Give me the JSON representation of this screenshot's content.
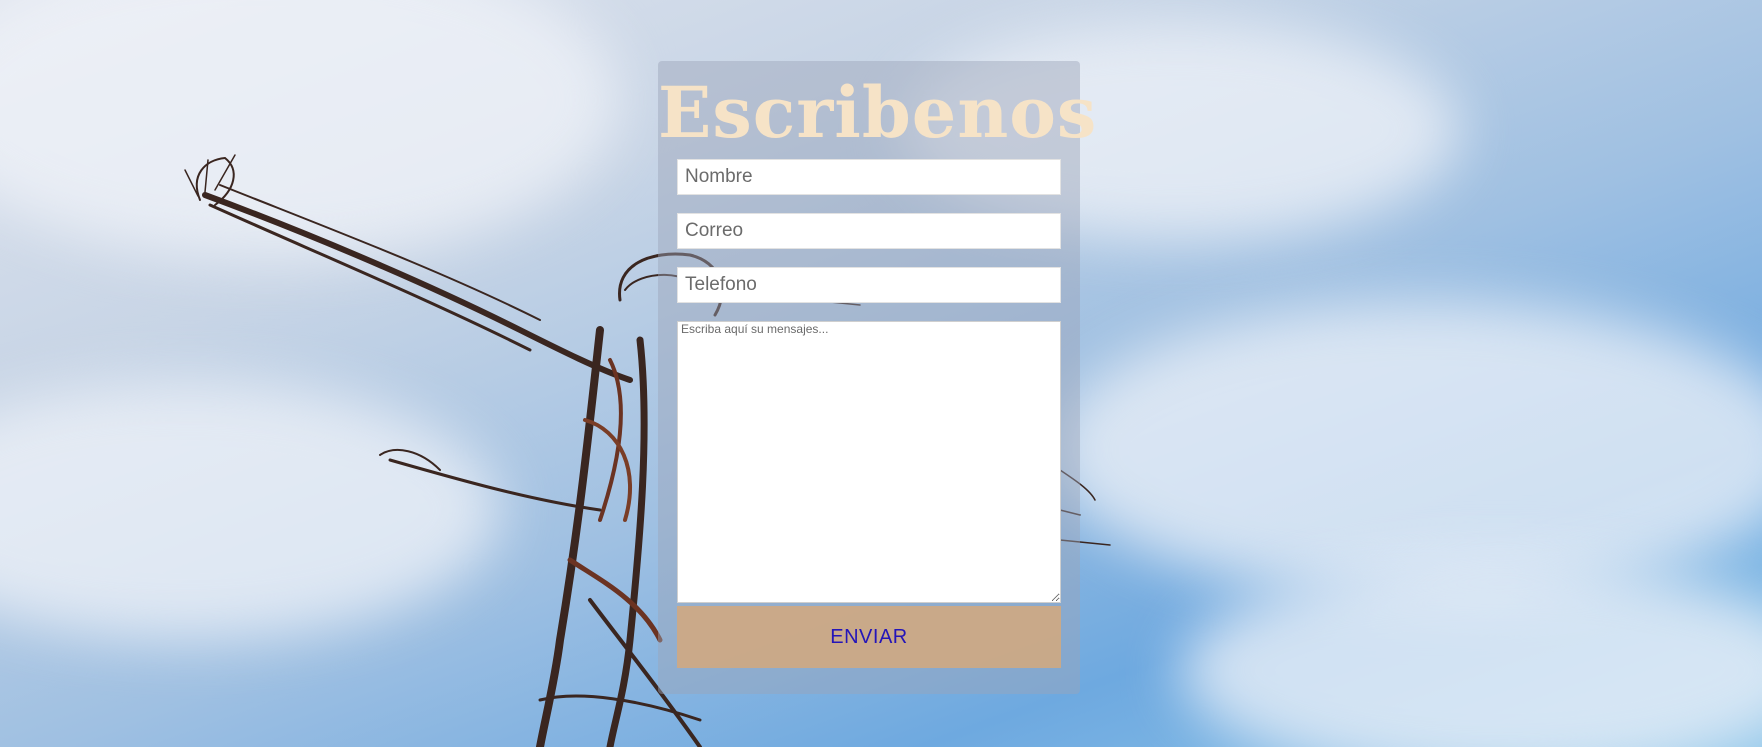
{
  "form": {
    "title": "Escribenos",
    "fields": {
      "name_placeholder": "Nombre",
      "email_placeholder": "Correo",
      "phone_placeholder": "Telefono",
      "message_placeholder": "Escriba aquí su mensajes..."
    },
    "submit_label": "ENVIAR"
  },
  "colors": {
    "title": "#f6e3c7",
    "button_bg": "#d2a880",
    "button_text": "#2415b8",
    "panel_overlay": "#9ba5b9"
  },
  "background": {
    "icon": "sculpture-photo"
  }
}
